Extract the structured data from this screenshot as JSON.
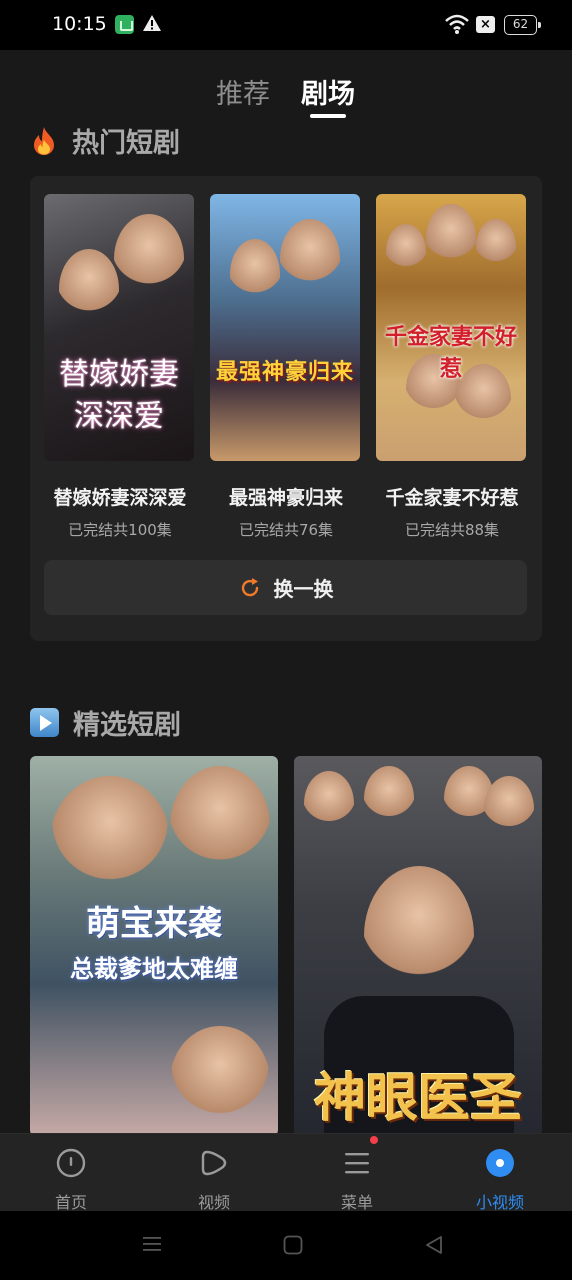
{
  "status_bar": {
    "time": "10:15",
    "battery": "62"
  },
  "tabs": [
    {
      "label": "推荐",
      "active": false
    },
    {
      "label": "剧场",
      "active": true
    }
  ],
  "hot_section": {
    "title": "热门短剧",
    "items": [
      {
        "title": "替嫁娇妻深深爱",
        "subtitle": "已完结共100集",
        "poster_line1": "替嫁娇妻",
        "poster_line2": "深深爱"
      },
      {
        "title": "最强神豪归来",
        "subtitle": "已完结共76集",
        "poster_text": "最强神豪归来"
      },
      {
        "title": "千金家妻不好惹",
        "subtitle": "已完结共88集",
        "poster_text": "千金家妻不好惹"
      }
    ],
    "refresh_label": "换一换"
  },
  "featured_section": {
    "title": "精选短剧",
    "items": [
      {
        "poster_line1": "萌宝来袭",
        "poster_line2": "总裁爹地太难缠"
      },
      {
        "poster_text": "神眼医圣"
      }
    ]
  },
  "bottom_nav": [
    {
      "label": "首页",
      "icon": "home-icon",
      "active": false
    },
    {
      "label": "视频",
      "icon": "video-icon",
      "active": false
    },
    {
      "label": "菜单",
      "icon": "menu-icon",
      "active": false,
      "badge": true
    },
    {
      "label": "小视频",
      "icon": "short-video-icon",
      "active": true
    }
  ],
  "colors": {
    "accent": "#2f8cf0",
    "refresh_icon": "#f07a2a",
    "badge": "#f2404a"
  }
}
